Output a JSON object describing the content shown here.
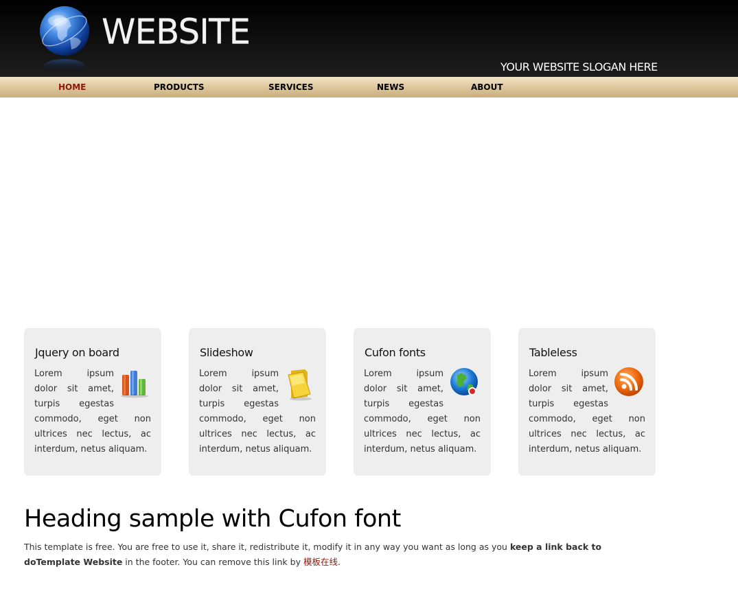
{
  "header": {
    "logo_text": "WEBSITE",
    "slogan": "YOUR WEBSITE SLOGAN HERE"
  },
  "nav": {
    "items": [
      {
        "label": "HOME",
        "active": true
      },
      {
        "label": "PRODUCTS",
        "active": false
      },
      {
        "label": "SERVICES",
        "active": false
      },
      {
        "label": "NEWS",
        "active": false
      },
      {
        "label": "ABOUT",
        "active": false
      }
    ]
  },
  "features": [
    {
      "title": "Jquery on board",
      "icon": "bar-chart-icon",
      "text": "Lorem ipsum dolor sit amet, turpis egestas commodo, eget non ultrices nec lectus, ac interdum, netus aliquam."
    },
    {
      "title": "Slideshow",
      "icon": "folder-icon",
      "text": "Lorem ipsum dolor sit amet, turpis egestas commodo, eget non ultrices nec lectus, ac interdum, netus aliquam."
    },
    {
      "title": "Cufon fonts",
      "icon": "globe-icon",
      "text": "Lorem ipsum dolor sit amet, turpis egestas commodo, eget non ultrices nec lectus, ac interdum, netus aliquam."
    },
    {
      "title": "Tableless",
      "icon": "rss-icon",
      "text": "Lorem ipsum dolor sit amet, turpis egestas commodo, eget non ultrices nec lectus, ac interdum, netus aliquam."
    }
  ],
  "content": {
    "heading": "Heading sample with Cufon font",
    "intro_before": "This template is free. You are free to use it, share it, redistribute it, modify it in any way you want as long as you ",
    "intro_bold": "keep a link back to doTemplate Website",
    "intro_middle": " in the footer. You can remove this link by ",
    "intro_link": "模板在线",
    "intro_end": "."
  },
  "colors": {
    "nav_active": "#8a1b0c",
    "header_bg": "#111111",
    "nav_bg": "#dcc59a",
    "box_bg": "#eeeeee"
  }
}
